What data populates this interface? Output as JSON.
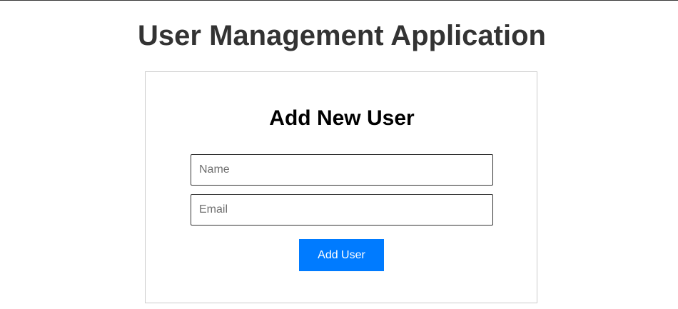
{
  "app": {
    "title": "User Management Application"
  },
  "form": {
    "title": "Add New User",
    "name_field": {
      "placeholder": "Name",
      "value": ""
    },
    "email_field": {
      "placeholder": "Email",
      "value": ""
    },
    "submit_label": "Add User"
  },
  "colors": {
    "primary_button": "#007bff",
    "title_text": "#333333",
    "card_border": "#cccccc"
  }
}
